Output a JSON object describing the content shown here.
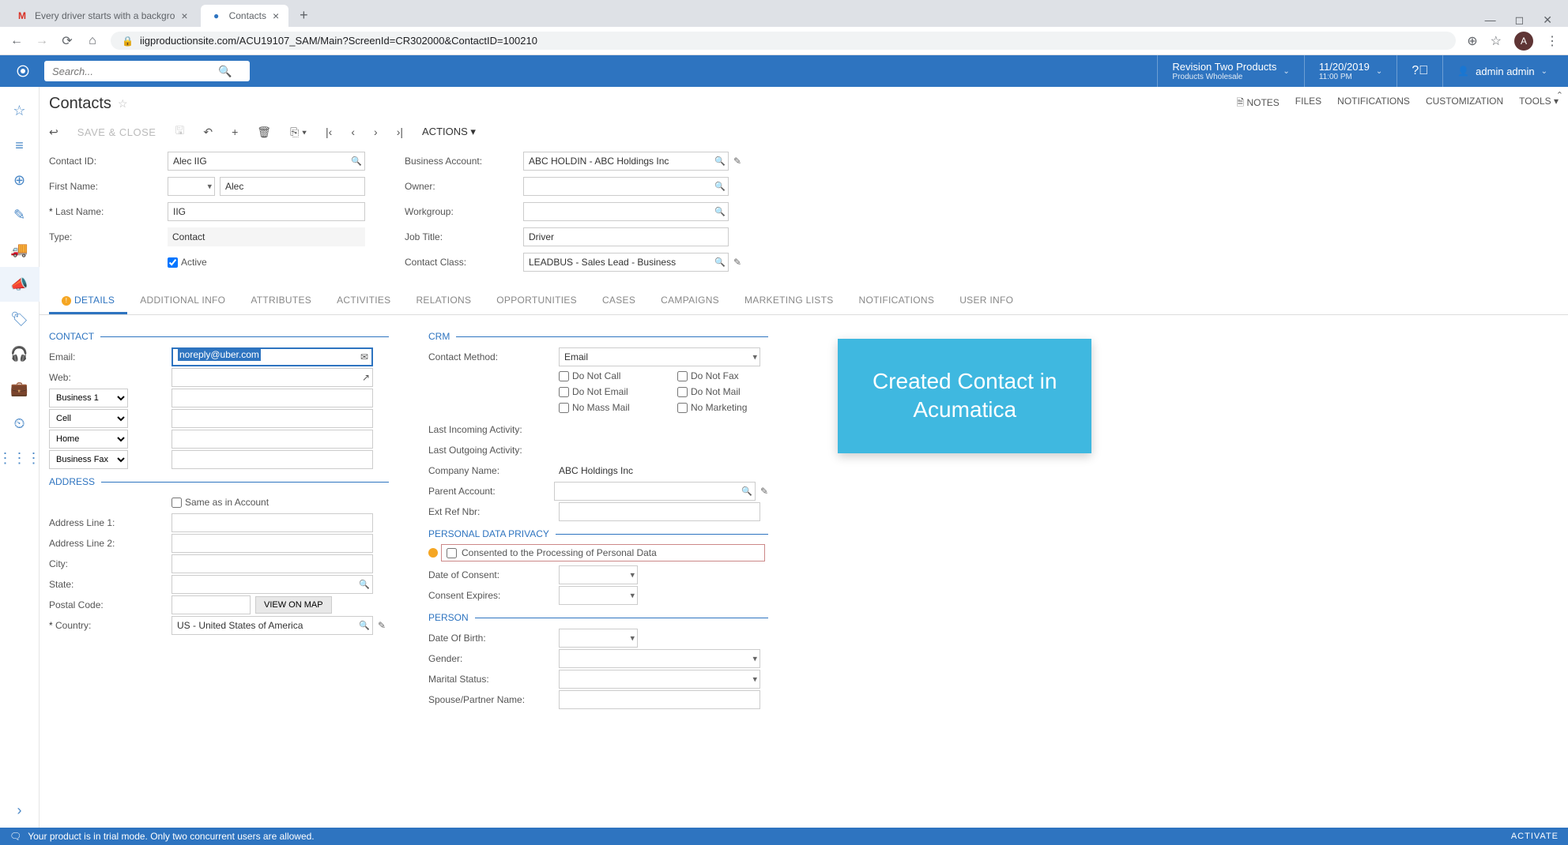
{
  "browser": {
    "tabs": [
      {
        "favicon": "M",
        "title": "Every driver starts with a backgro"
      },
      {
        "favicon": "●",
        "title": "Contacts"
      }
    ],
    "url": "iigproductionsite.com/ACU19107_SAM/Main?ScreenId=CR302000&ContactID=100210",
    "avatar_letter": "A"
  },
  "app_header": {
    "search_placeholder": "Search...",
    "company": "Revision Two Products",
    "company_sub": "Products Wholesale",
    "date": "11/20/2019",
    "time": "11:00 PM",
    "user": "admin admin"
  },
  "title_bar": {
    "title": "Contacts",
    "right": [
      "NOTES",
      "FILES",
      "NOTIFICATIONS",
      "CUSTOMIZATION",
      "TOOLS ▾"
    ]
  },
  "toolbar": {
    "save_close": "SAVE & CLOSE",
    "actions": "ACTIONS ▾"
  },
  "form_top": {
    "contact_id_label": "Contact ID:",
    "contact_id_value": "Alec IIG",
    "first_name_label": "First Name:",
    "first_name_prefix": "",
    "first_name_value": "Alec",
    "last_name_label": "Last Name:",
    "last_name_value": "IIG",
    "type_label": "Type:",
    "type_value": "Contact",
    "active_label": "Active",
    "business_account_label": "Business Account:",
    "business_account_value": "ABC HOLDIN - ABC Holdings Inc",
    "owner_label": "Owner:",
    "owner_value": "",
    "workgroup_label": "Workgroup:",
    "workgroup_value": "",
    "job_title_label": "Job Title:",
    "job_title_value": "Driver",
    "contact_class_label": "Contact Class:",
    "contact_class_value": "LEADBUS - Sales Lead - Business"
  },
  "tabs": [
    "DETAILS",
    "ADDITIONAL INFO",
    "ATTRIBUTES",
    "ACTIVITIES",
    "RELATIONS",
    "OPPORTUNITIES",
    "CASES",
    "CAMPAIGNS",
    "MARKETING LISTS",
    "NOTIFICATIONS",
    "USER INFO"
  ],
  "contact_section": {
    "hdr": "CONTACT",
    "email_label": "Email:",
    "email_value": "noreply@uber.com",
    "web_label": "Web:",
    "web_value": "",
    "phone_types": [
      "Business 1",
      "Cell",
      "Home",
      "Business Fax"
    ]
  },
  "address_section": {
    "hdr": "ADDRESS",
    "same_as": "Same as in Account",
    "addr1_label": "Address Line 1:",
    "addr2_label": "Address Line 2:",
    "city_label": "City:",
    "state_label": "State:",
    "postal_label": "Postal Code:",
    "view_map": "VIEW ON MAP",
    "country_label": "Country:",
    "country_value": "US - United States of America"
  },
  "crm_section": {
    "hdr": "CRM",
    "method_label": "Contact Method:",
    "method_value": "Email",
    "checkboxes": [
      "Do Not Call",
      "Do Not Fax",
      "Do Not Email",
      "Do Not Mail",
      "No Mass Mail",
      "No Marketing"
    ],
    "last_in_label": "Last Incoming Activity:",
    "last_out_label": "Last Outgoing Activity:",
    "company_label": "Company Name:",
    "company_value": "ABC Holdings Inc",
    "parent_label": "Parent Account:",
    "ext_ref_label": "Ext Ref Nbr:"
  },
  "privacy_section": {
    "hdr": "PERSONAL DATA PRIVACY",
    "consent_label": "Consented to the Processing of Personal Data",
    "doc_label": "Date of Consent:",
    "exp_label": "Consent Expires:"
  },
  "person_section": {
    "hdr": "PERSON",
    "dob_label": "Date Of Birth:",
    "gender_label": "Gender:",
    "marital_label": "Marital Status:",
    "spouse_label": "Spouse/Partner Name:"
  },
  "callout": {
    "line1": "Created Contact in",
    "line2": "Acumatica"
  },
  "footer": {
    "msg": "Your product is in trial mode. Only two concurrent users are allowed.",
    "activate": "ACTIVATE"
  }
}
